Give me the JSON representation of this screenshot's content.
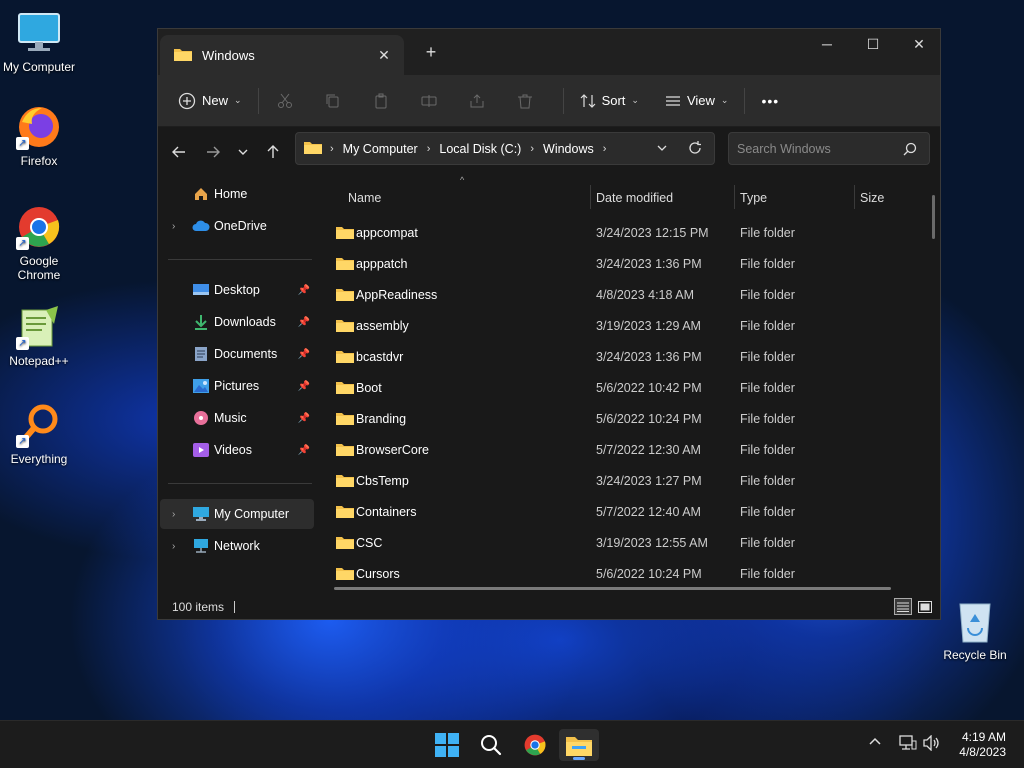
{
  "desktop": {
    "icons": [
      {
        "label": "My Computer",
        "icon": "monitor-icon"
      },
      {
        "label": "Firefox",
        "icon": "firefox-icon"
      },
      {
        "label": "Google Chrome",
        "icon": "chrome-icon"
      },
      {
        "label": "Notepad++",
        "icon": "notepad-plus-plus-icon"
      },
      {
        "label": "Everything",
        "icon": "everything-search-icon"
      },
      {
        "label": "Recycle Bin",
        "icon": "recycle-bin-icon"
      }
    ]
  },
  "explorer": {
    "tab_title": "Windows",
    "toolbar": {
      "new_label": "New",
      "sort_label": "Sort",
      "view_label": "View",
      "more_label": "•••"
    },
    "address": {
      "crumbs": [
        "My Computer",
        "Local Disk (C:)",
        "Windows"
      ]
    },
    "search": {
      "placeholder": "Search Windows"
    },
    "sidebar": {
      "home": "Home",
      "onedrive": "OneDrive",
      "pinned": [
        {
          "label": "Desktop",
          "icon": "desktop-icon",
          "color": "#3f8ee8"
        },
        {
          "label": "Downloads",
          "icon": "download-icon",
          "color": "#3fb86f"
        },
        {
          "label": "Documents",
          "icon": "document-icon",
          "color": "#8aa4c8"
        },
        {
          "label": "Pictures",
          "icon": "picture-icon",
          "color": "#3f9fe8"
        },
        {
          "label": "Music",
          "icon": "music-icon",
          "color": "#e8709a"
        },
        {
          "label": "Videos",
          "icon": "video-icon",
          "color": "#a45ee8"
        }
      ],
      "my_computer": "My Computer",
      "network": "Network"
    },
    "columns": {
      "name": "Name",
      "date": "Date modified",
      "type": "Type",
      "size": "Size"
    },
    "rows": [
      {
        "name": "appcompat",
        "date": "3/24/2023 12:15 PM",
        "type": "File folder"
      },
      {
        "name": "apppatch",
        "date": "3/24/2023 1:36 PM",
        "type": "File folder"
      },
      {
        "name": "AppReadiness",
        "date": "4/8/2023 4:18 AM",
        "type": "File folder"
      },
      {
        "name": "assembly",
        "date": "3/19/2023 1:29 AM",
        "type": "File folder"
      },
      {
        "name": "bcastdvr",
        "date": "3/24/2023 1:36 PM",
        "type": "File folder"
      },
      {
        "name": "Boot",
        "date": "5/6/2022 10:42 PM",
        "type": "File folder"
      },
      {
        "name": "Branding",
        "date": "5/6/2022 10:24 PM",
        "type": "File folder"
      },
      {
        "name": "BrowserCore",
        "date": "5/7/2022 12:30 AM",
        "type": "File folder"
      },
      {
        "name": "CbsTemp",
        "date": "3/24/2023 1:27 PM",
        "type": "File folder"
      },
      {
        "name": "Containers",
        "date": "5/7/2022 12:40 AM",
        "type": "File folder"
      },
      {
        "name": "CSC",
        "date": "3/19/2023 12:55 AM",
        "type": "File folder"
      },
      {
        "name": "Cursors",
        "date": "5/6/2022 10:24 PM",
        "type": "File folder"
      }
    ],
    "status": "100 items"
  },
  "taskbar": {
    "clock_time": "4:19 AM",
    "clock_date": "4/8/2023",
    "accent": "#6aa7ff"
  }
}
